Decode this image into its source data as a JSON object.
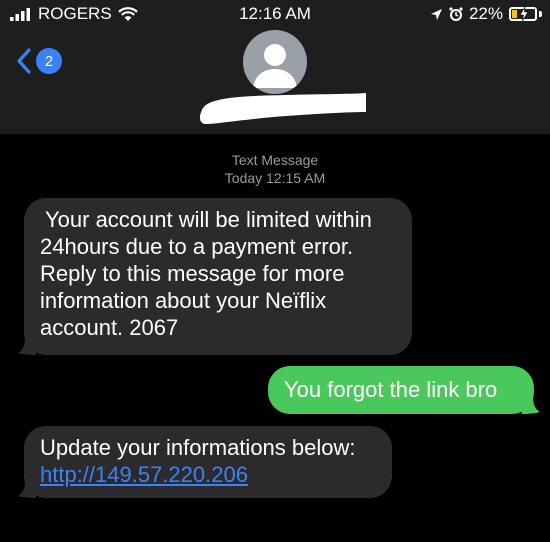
{
  "status_bar": {
    "carrier": "ROGERS",
    "time": "12:16 AM",
    "battery": "22%",
    "battery_level": 0.22
  },
  "nav": {
    "back_badge": "2"
  },
  "conversation": {
    "type_label": "Text Message",
    "timestamp": "Today 12:15 AM"
  },
  "messages": [
    {
      "direction": "incoming",
      "lines": [
        "Your account will be limited within",
        "24hours due to a payment error.",
        "Reply to this  message for more",
        "information about your Neïflix",
        "account. 2067"
      ]
    },
    {
      "direction": "outgoing",
      "lines": [
        "You forgot the link bro"
      ]
    },
    {
      "direction": "incoming",
      "lines": [
        "Update your informations below:",
        "http://149.57.220.206"
      ]
    }
  ],
  "colors": {
    "header_bg": "#1e1e1e",
    "incoming_bubble": "#2b2b2e",
    "outgoing_bubble": "#4ac85c",
    "link": "#3d83f5",
    "badge": "#3a82f7"
  }
}
